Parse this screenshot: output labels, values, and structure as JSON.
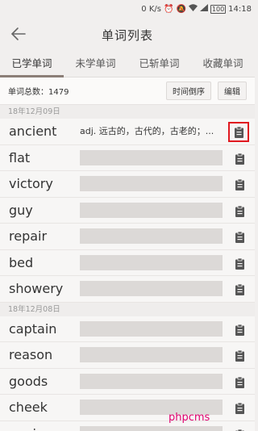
{
  "status": {
    "speed": "0 K/s",
    "battery": "100",
    "time": "14:18"
  },
  "appbar": {
    "title": "单词列表"
  },
  "tabs": [
    "已学单词",
    "未学单词",
    "已斩单词",
    "收藏单词"
  ],
  "toolbar": {
    "total": "单词总数：1479",
    "sort_label": "时间倒序",
    "edit_label": "编辑"
  },
  "sections": [
    {
      "date": "18年12月09日",
      "words": [
        {
          "word": "ancient",
          "definition": "adj. 远古的，古代的，古老的；..."
        },
        {
          "word": "flat",
          "definition": ""
        },
        {
          "word": "victory",
          "definition": ""
        },
        {
          "word": "guy",
          "definition": ""
        },
        {
          "word": "repair",
          "definition": ""
        },
        {
          "word": "bed",
          "definition": ""
        },
        {
          "word": "showery",
          "definition": ""
        }
      ]
    },
    {
      "date": "18年12月08日",
      "words": [
        {
          "word": "captain",
          "definition": ""
        },
        {
          "word": "reason",
          "definition": ""
        },
        {
          "word": "goods",
          "definition": ""
        },
        {
          "word": "cheek",
          "definition": ""
        },
        {
          "word": "environmental",
          "definition": ""
        }
      ]
    }
  ],
  "watermark": "phpcms",
  "colors": {
    "tab_indicator": "#8b7e77",
    "highlight_box": "#e0181f",
    "watermark": "#e0006f"
  }
}
